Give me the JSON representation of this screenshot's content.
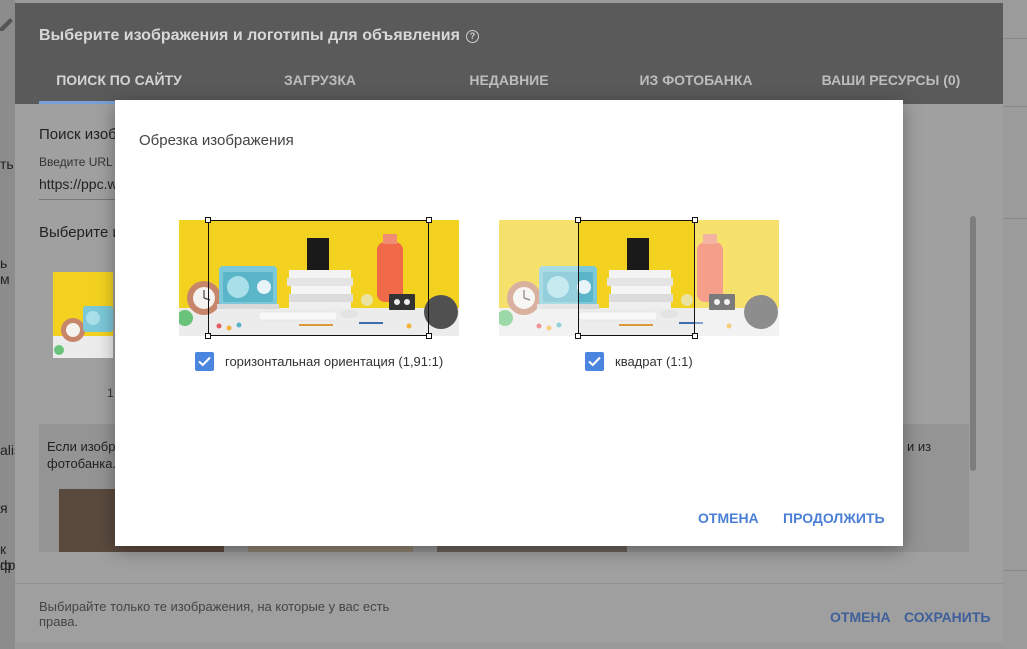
{
  "outer_dialog": {
    "title": "Выберите изображения и логотипы для объявления",
    "help": "?",
    "tabs": [
      {
        "label": "ПОИСК ПО САЙТУ"
      },
      {
        "label": "ЗАГРУЗКА"
      },
      {
        "label": "НЕДАВНИЕ"
      },
      {
        "label": "ИЗ ФОТОБАНКА"
      },
      {
        "label": "ВАШИ РЕСУРСЫ (0)"
      }
    ],
    "search_label": "Поиск изоб",
    "url_hint": "Введите URL",
    "url_value": "https://ppc.w",
    "select_label": "Выберите и",
    "thumb_caption": "1",
    "info_text_line1": "Если изобр",
    "info_text_line2": "фотобанка.",
    "info_text_right": "и из",
    "footer_note": "Выбирайте только те изображения, на которые у вас есть права.",
    "cancel": "ОТМЕНА",
    "save": "СОХРАНИТЬ"
  },
  "background_fragments": {
    "f1": "ть",
    "f2": "ь м",
    "f3": "alis",
    "f4": "я",
    "f5": "к ф",
    "f6": "пр"
  },
  "crop_dialog": {
    "title": "Обрезка изображения",
    "options": [
      {
        "label": "горизонтальная ориентация (1,91:1)",
        "checked": true
      },
      {
        "label": "квадрат (1:1)",
        "checked": true
      }
    ],
    "cancel": "ОТМЕНА",
    "continue": "ПРОДОЛЖИТЬ"
  },
  "colors": {
    "accent": "#4a85e0",
    "button_text": "#4a7fd6",
    "outer_header": "#5a5a5a"
  }
}
